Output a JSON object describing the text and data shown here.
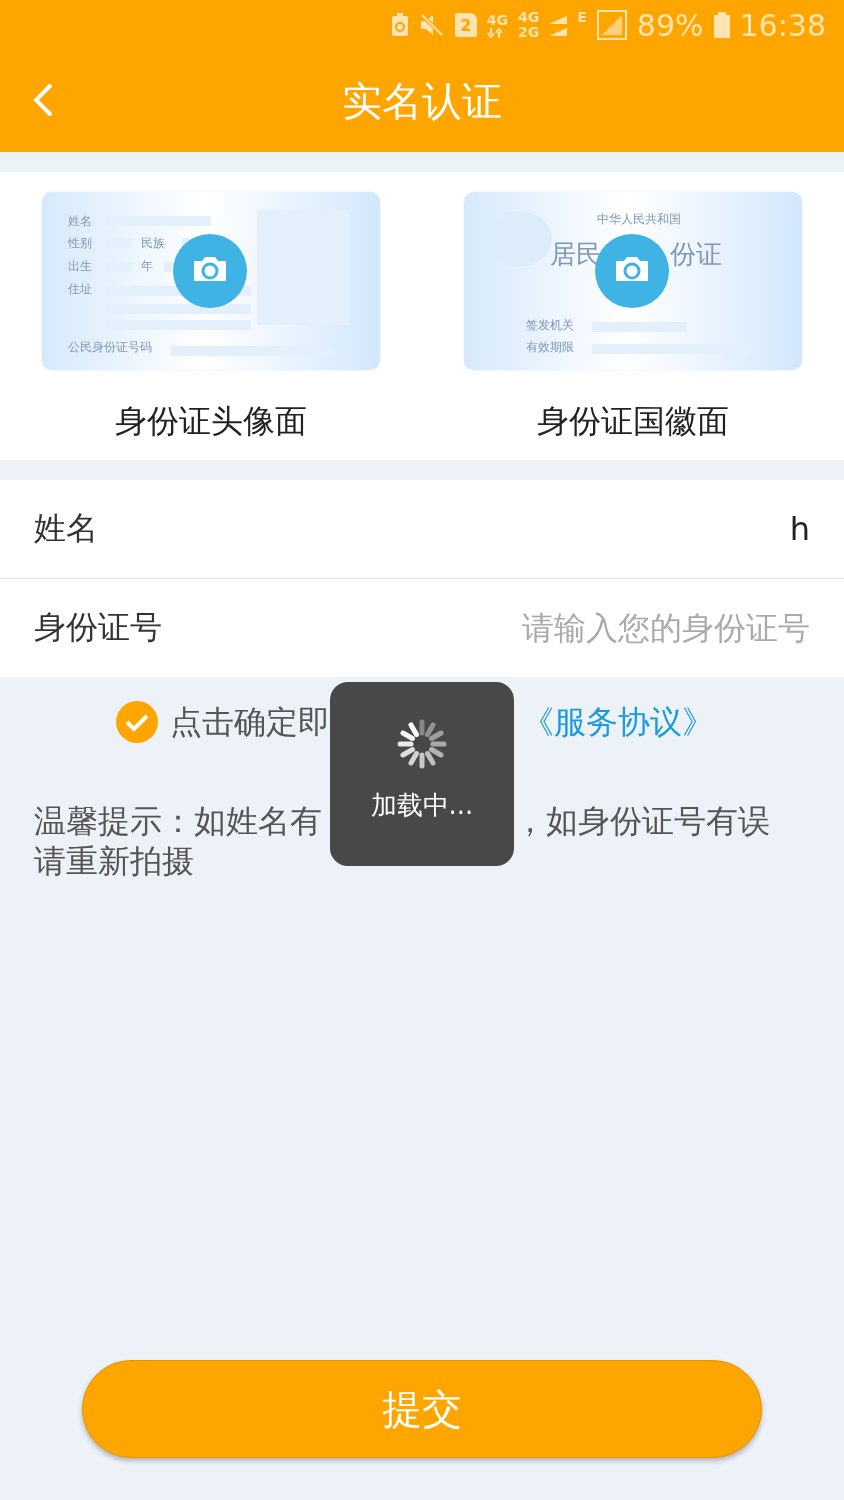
{
  "status_bar": {
    "sim_slot": "2",
    "network_a": "4G",
    "network_b_top": "4G",
    "network_b_bottom": "2G",
    "data_type": "E",
    "battery": "89%",
    "time": "16:38"
  },
  "header": {
    "title": "实名认证"
  },
  "id_cards": [
    {
      "kind": "front",
      "caption": "身份证头像面",
      "texts": [
        "姓名",
        "性别",
        "民族",
        "出生",
        "年",
        "住址",
        "公民身份证号码"
      ]
    },
    {
      "kind": "back",
      "caption": "身份证国徽面",
      "texts": [
        "中华人民共和国",
        "居民",
        "份证",
        "签发机关",
        "有效期限"
      ]
    }
  ],
  "form": [
    {
      "label": "姓名",
      "value": "h"
    },
    {
      "label": "身份证号",
      "placeholder": "请输入您的身份证号"
    }
  ],
  "agreement": {
    "checked": true,
    "text": "点击确定即",
    "link": "《服务协议》"
  },
  "tip": {
    "before": "温馨提示：如姓名有",
    "after": "，如身份证号有误",
    "line_2": "请重新拍摄"
  },
  "loading_toast": {
    "text": "加载中..."
  },
  "submit_button": "提交"
}
